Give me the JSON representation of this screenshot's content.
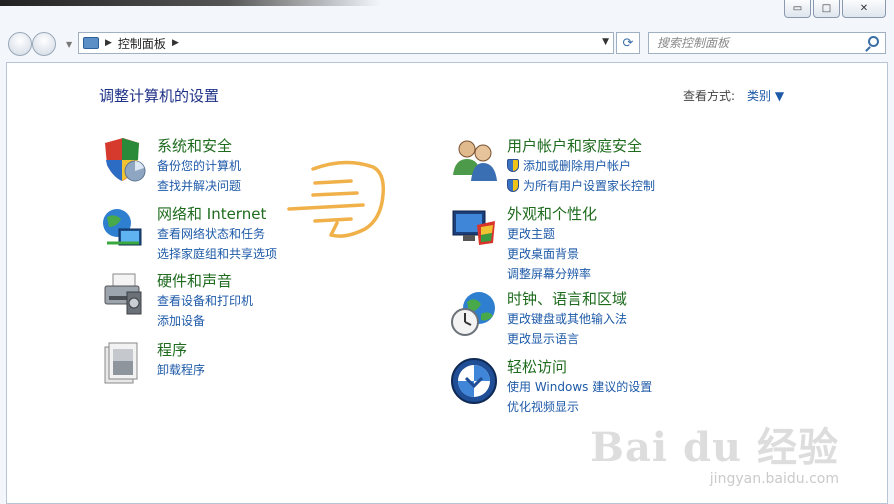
{
  "window": {
    "minimize_glyph": "▭",
    "maximize_glyph": "□",
    "close_glyph": "✕"
  },
  "addressbar": {
    "breadcrumb_arrow": "▶",
    "crumb": "控制面板",
    "crumb_arrow_after": "▶",
    "dropdown_glyph": "▼",
    "refresh_glyph": "⟳"
  },
  "search": {
    "placeholder": "搜索控制面板"
  },
  "main": {
    "title": "调整计算机的设置",
    "view_by_label": "查看方式:",
    "view_by_value": "类别 ▼"
  },
  "categories": [
    {
      "title": "系统和安全",
      "links": [
        "备份您的计算机",
        "查找并解决问题"
      ]
    },
    {
      "title": "网络和 Internet",
      "links": [
        "查看网络状态和任务",
        "选择家庭组和共享选项"
      ]
    },
    {
      "title": "硬件和声音",
      "links": [
        "查看设备和打印机",
        "添加设备"
      ]
    },
    {
      "title": "程序",
      "links": [
        "卸载程序"
      ]
    },
    {
      "title": "用户帐户和家庭安全",
      "links": [
        "添加或删除用户帐户",
        "为所有用户设置家长控制"
      ]
    },
    {
      "title": "外观和个性化",
      "links": [
        "更改主题",
        "更改桌面背景",
        "调整屏幕分辨率"
      ]
    },
    {
      "title": "时钟、语言和区域",
      "links": [
        "更改键盘或其他输入法",
        "更改显示语言"
      ]
    },
    {
      "title": "轻松访问",
      "links": [
        "使用 Windows 建议的设置",
        "优化视频显示"
      ]
    }
  ],
  "watermark": {
    "logo": "Bai du 经验",
    "url": "jingyan.baidu.com"
  },
  "colors": {
    "category_title": "#1e6b1e",
    "link": "#1e5aa8",
    "title": "#1e3287"
  }
}
